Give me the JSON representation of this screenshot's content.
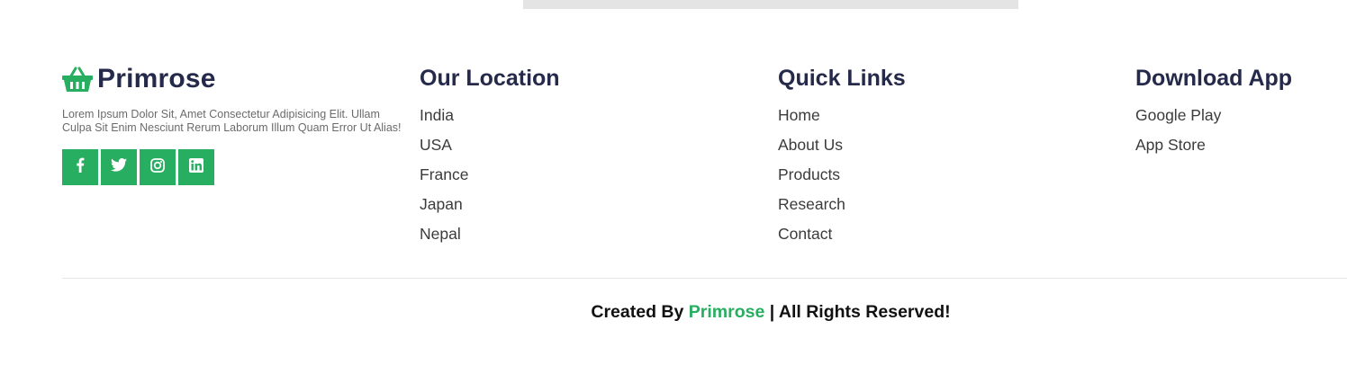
{
  "brand": {
    "name": "Primrose",
    "description": "Lorem Ipsum Dolor Sit, Amet Consectetur Adipisicing Elit. Ullam Culpa Sit Enim Nesciunt Rerum Laborum Illum Quam Error Ut Alias!",
    "icon": "basket-icon",
    "accent_color": "#27ae60",
    "social": [
      {
        "name": "facebook",
        "icon": "facebook-icon"
      },
      {
        "name": "twitter",
        "icon": "twitter-icon"
      },
      {
        "name": "instagram",
        "icon": "instagram-icon"
      },
      {
        "name": "linkedin",
        "icon": "linkedin-icon"
      }
    ]
  },
  "location": {
    "title": "Our Location",
    "items": [
      "India",
      "USA",
      "France",
      "Japan",
      "Nepal"
    ]
  },
  "quick_links": {
    "title": "Quick Links",
    "items": [
      "Home",
      "About Us",
      "Products",
      "Research",
      "Contact"
    ]
  },
  "download": {
    "title": "Download App",
    "items": [
      "Google Play",
      "App Store"
    ]
  },
  "credit": {
    "prefix": "Created By",
    "brand": "Primrose",
    "suffix": "| All Rights Reserved!"
  }
}
